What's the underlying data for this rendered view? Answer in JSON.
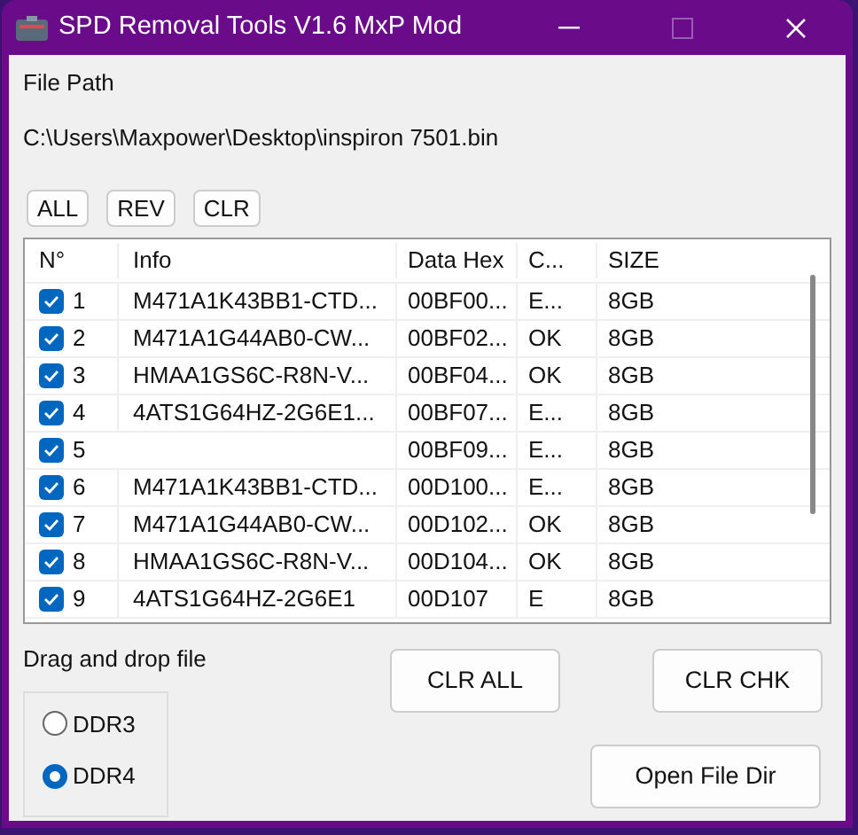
{
  "window": {
    "title": "SPD Removal Tools V1.6 MxP Mod"
  },
  "file_path_label": "File Path",
  "file_path": "C:\\Users\\Maxpower\\Desktop\\inspiron 7501.bin",
  "select_buttons": [
    "ALL",
    "REV",
    "CLR"
  ],
  "table": {
    "columns": [
      "N°",
      "Info",
      "Data Hex",
      "C...",
      "SIZE"
    ],
    "rows": [
      {
        "checked": true,
        "cells": [
          "1",
          "M471A1K43BB1-CTD...",
          "00BF00...",
          "E...",
          "8GB"
        ]
      },
      {
        "checked": true,
        "cells": [
          "2",
          "M471A1G44AB0-CW...",
          "00BF02...",
          "OK",
          "8GB"
        ]
      },
      {
        "checked": true,
        "cells": [
          "3",
          "HMAA1GS6C-R8N-V...",
          "00BF04...",
          "OK",
          "8GB"
        ]
      },
      {
        "checked": true,
        "cells": [
          "4",
          "4ATS1G64HZ-2G6E1...",
          "00BF07...",
          "E...",
          "8GB"
        ]
      },
      {
        "checked": true,
        "cells": [
          "5",
          "",
          "00BF09...",
          "E...",
          "8GB"
        ]
      },
      {
        "checked": true,
        "cells": [
          "6",
          "M471A1K43BB1-CTD...",
          "00D100...",
          "E...",
          "8GB"
        ]
      },
      {
        "checked": true,
        "cells": [
          "7",
          "M471A1G44AB0-CW...",
          "00D102...",
          "OK",
          "8GB"
        ]
      },
      {
        "checked": true,
        "cells": [
          "8",
          "HMAA1GS6C-R8N-V...",
          "00D104...",
          "OK",
          "8GB"
        ]
      },
      {
        "checked": true,
        "cells": [
          "9",
          "4ATS1G64HZ-2G6E1",
          "00D107",
          "E",
          "8GB"
        ]
      }
    ]
  },
  "drop_hint": "Drag and drop file",
  "memory_types": [
    {
      "label": "DDR3",
      "selected": false
    },
    {
      "label": "DDR4",
      "selected": true
    }
  ],
  "action_buttons": [
    "CLR ALL",
    "CLR CHK",
    "Open File Dir"
  ]
}
